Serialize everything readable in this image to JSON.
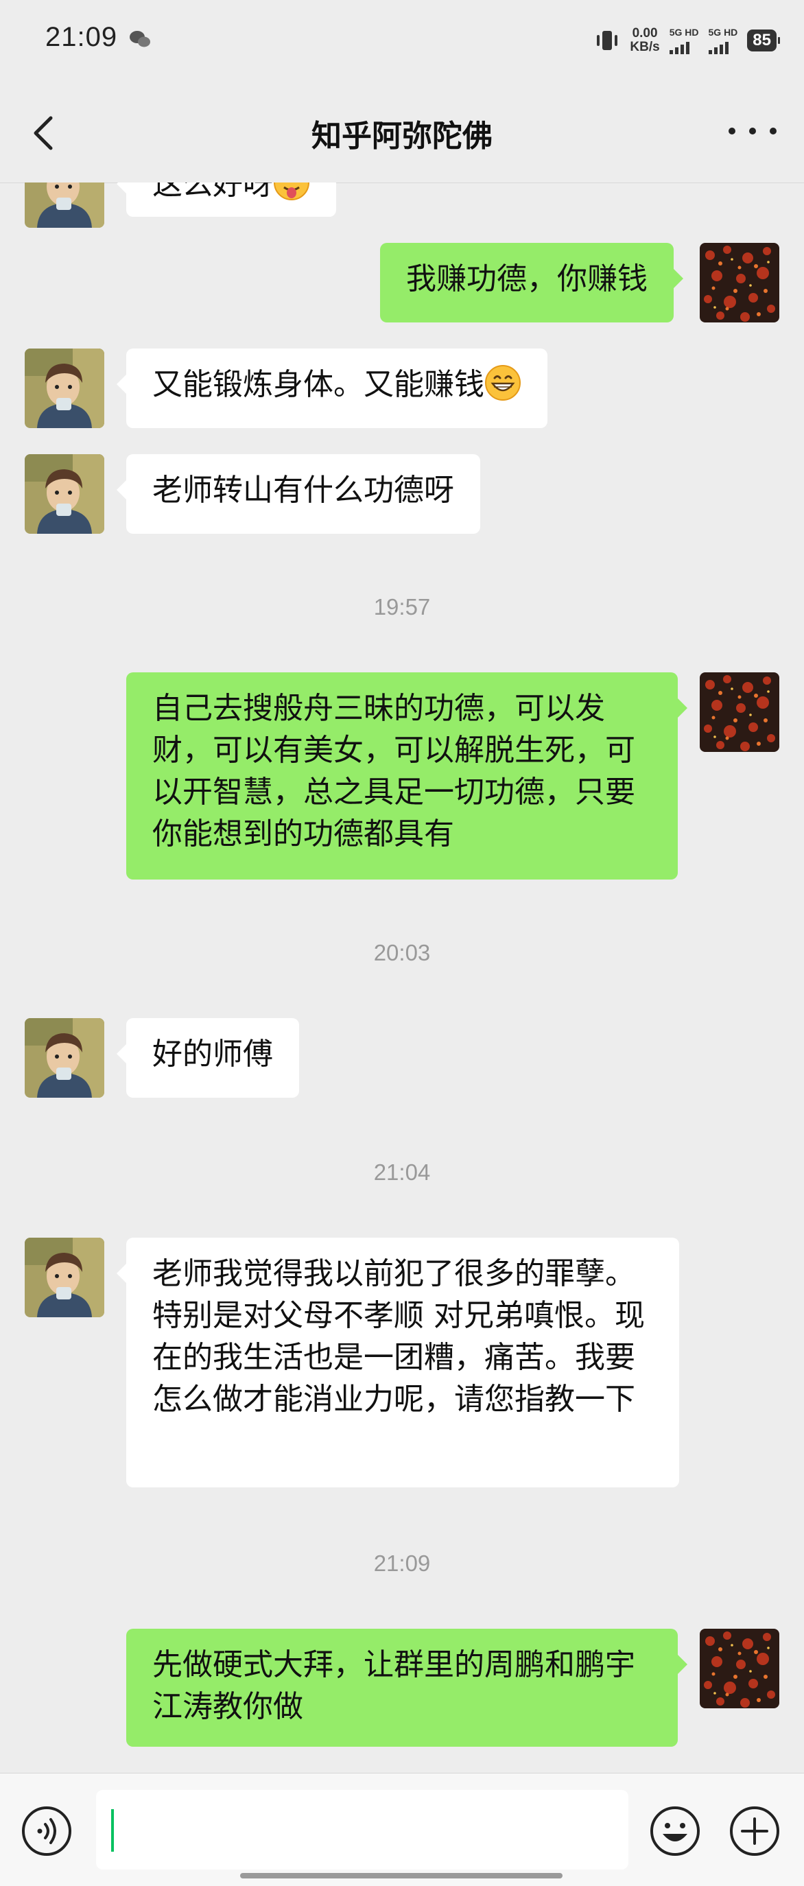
{
  "status_bar": {
    "time": "21:09",
    "net_speed_value": "0.00",
    "net_speed_unit": "KB/s",
    "sim1_label": "5G HD",
    "sim2_label": "5G HD",
    "battery": "85"
  },
  "header": {
    "title": "知乎阿弥陀佛"
  },
  "messages": [
    {
      "side": "in",
      "text": "这么好呀",
      "emoji": "face-tongue-icon"
    },
    {
      "side": "out",
      "text": "我赚功德，你赚钱"
    },
    {
      "side": "in",
      "text": "又能锻炼身体。又能赚钱",
      "emoji": "grinning-face-icon"
    },
    {
      "side": "in",
      "text": "老师转山有什么功德呀"
    },
    {
      "timestamp": "19:57"
    },
    {
      "side": "out",
      "text": "自己去搜般舟三昧的功德，可以发财，可以有美女，可以解脱生死，可以开智慧，总之具足一切功德，只要你能想到的功德都具有"
    },
    {
      "timestamp": "20:03"
    },
    {
      "side": "in",
      "text": "好的师傅"
    },
    {
      "timestamp": "21:04"
    },
    {
      "side": "in",
      "text": "老师我觉得我以前犯了很多的罪孽。特别是对父母不孝顺 对兄弟嗔恨。现在的我生活也是一团糟，痛苦。我要怎么做才能消业力呢，请您指教一下"
    },
    {
      "timestamp": "21:09"
    },
    {
      "side": "out",
      "text": "先做硬式大拜，让群里的周鹏和鹏宇江涛教你做"
    }
  ],
  "input": {
    "value": ""
  },
  "colors": {
    "background": "#ededed",
    "outgoing_bubble": "#95ec69",
    "incoming_bubble": "#ffffff",
    "caret": "#07c160",
    "timestamp_text": "#999999"
  }
}
